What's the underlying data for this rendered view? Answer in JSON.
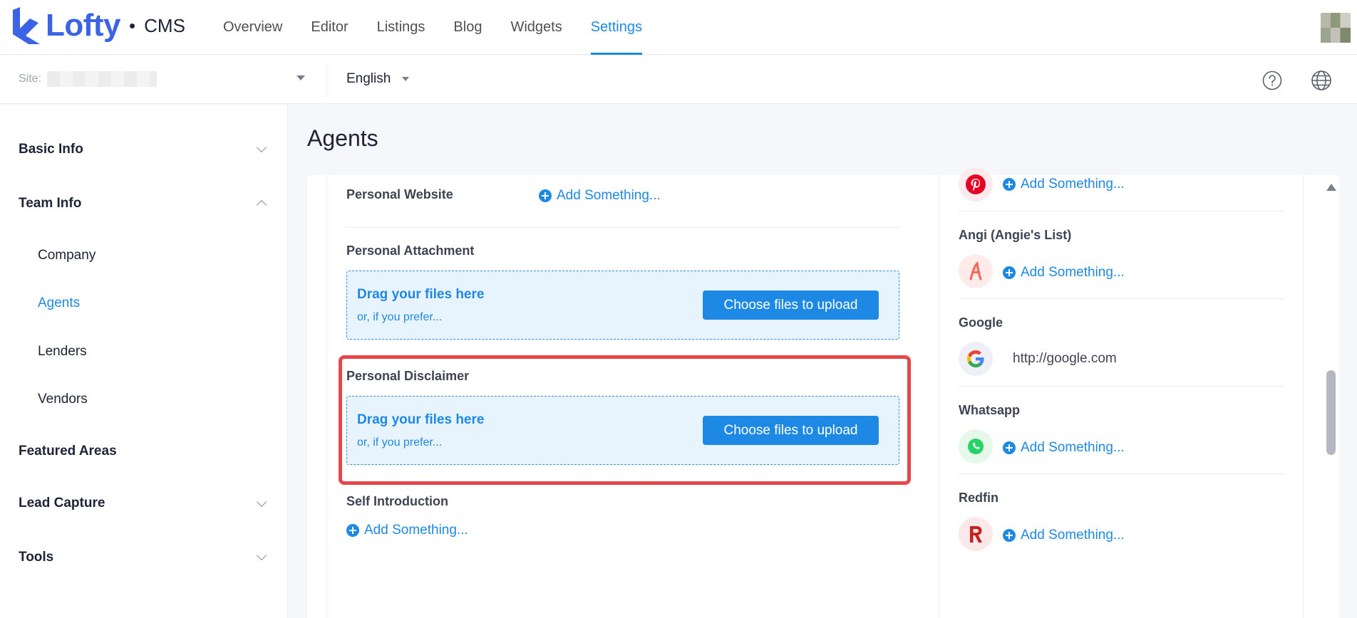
{
  "brand": {
    "name": "Lofty",
    "separator": "•",
    "product": "CMS",
    "color": "#3a63e6"
  },
  "nav": {
    "items": [
      "Overview",
      "Editor",
      "Listings",
      "Blog",
      "Widgets",
      "Settings"
    ],
    "active": "Settings"
  },
  "subbar": {
    "site_label": "Site:",
    "language": "English"
  },
  "sidebar": {
    "basic_info": "Basic Info",
    "team_info": "Team Info",
    "team_children": [
      "Company",
      "Agents",
      "Lenders",
      "Vendors"
    ],
    "active_child": "Agents",
    "featured_areas": "Featured Areas",
    "lead_capture": "Lead Capture",
    "tools": "Tools"
  },
  "main": {
    "title": "Agents",
    "personal_website": {
      "label": "Personal Website",
      "add_label": "Add Something..."
    },
    "personal_attachment": {
      "label": "Personal Attachment",
      "drop_title": "Drag your files here",
      "drop_sub": "or, if you prefer...",
      "button": "Choose files to upload"
    },
    "personal_disclaimer": {
      "label": "Personal Disclaimer",
      "drop_title": "Drag your files here",
      "drop_sub": "or, if you prefer...",
      "button": "Choose files to upload"
    },
    "self_introduction": {
      "label": "Self Introduction",
      "add_label": "Add Something..."
    }
  },
  "socials": {
    "pinterest": {
      "add_label": "Add Something...",
      "icon": "pinterest-icon",
      "color": "#e60023"
    },
    "angi": {
      "label": "Angi (Angie's List)",
      "add_label": "Add Something...",
      "icon": "angi-icon",
      "color": "#ff6153"
    },
    "google": {
      "label": "Google",
      "value": "http://google.com",
      "icon": "google-icon"
    },
    "whatsapp": {
      "label": "Whatsapp",
      "add_label": "Add Something...",
      "icon": "whatsapp-icon",
      "color": "#25d366"
    },
    "redfin": {
      "label": "Redfin",
      "add_label": "Add Something...",
      "icon": "redfin-icon",
      "color": "#c82021"
    }
  },
  "colors": {
    "accent": "#1e88e5",
    "highlight": "#e6474a"
  }
}
